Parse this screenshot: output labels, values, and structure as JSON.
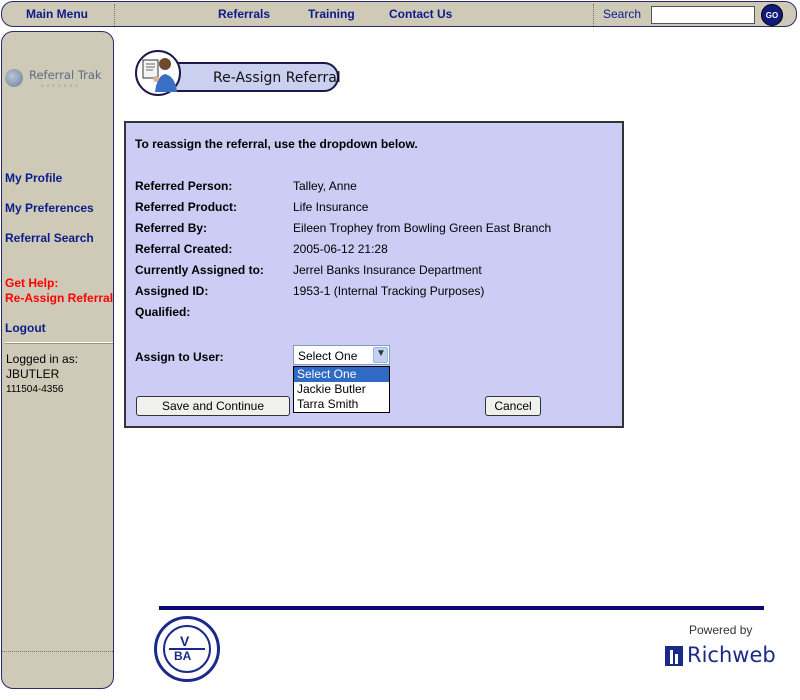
{
  "topbar": {
    "main_menu": "Main Menu",
    "links": [
      "Referrals",
      "Training",
      "Contact Us"
    ],
    "search_label": "Search",
    "search_value": "",
    "go_label": "GO"
  },
  "sidebar": {
    "logo_text": "Referral Trak",
    "logo_sub": "EXPRESS",
    "links": [
      "My Profile",
      "My Preferences",
      "Referral Search"
    ],
    "help_heading": "Get Help:",
    "help_link": "Re-Assign Referral",
    "logout": "Logout",
    "logged_in_label": "Logged in as:",
    "username": "JBUTLER",
    "user_id": "111504-4356"
  },
  "page": {
    "title": "Re-Assign Referral"
  },
  "form": {
    "intro": "To reassign the referral, use the dropdown below.",
    "fields": [
      {
        "label": "Referred Person:",
        "value": "Talley, Anne"
      },
      {
        "label": "Referred Product:",
        "value": "Life Insurance"
      },
      {
        "label": "Referred By:",
        "value": "Eileen Trophey from Bowling Green East Branch"
      },
      {
        "label": "Referral Created:",
        "value": "2005-06-12 21:28"
      },
      {
        "label": "Currently Assigned to:",
        "value": "Jerrel Banks Insurance Department"
      },
      {
        "label": "Assigned ID:",
        "value": "1953-1 (Internal Tracking Purposes)"
      },
      {
        "label": "Qualified:",
        "value": ""
      }
    ],
    "assign_label": "Assign to User:",
    "assign_selected": "Select One",
    "assign_options": [
      "Select One",
      "Jackie Butler",
      "Tarra Smith"
    ],
    "save_label": "Save and Continue",
    "cancel_label": "Cancel"
  },
  "footer": {
    "vba_letters_top": "V",
    "vba_letters_bottom": "BA",
    "powered_by": "Powered by",
    "brand": "Richweb"
  },
  "colors": {
    "nav_bg": "#cfc9b7",
    "link_blue": "#0b1c8a",
    "help_red": "#ff0000",
    "panel_bg": "#ccccf4",
    "selection_blue": "#316ac5",
    "footer_rule": "#0a0a6e"
  }
}
